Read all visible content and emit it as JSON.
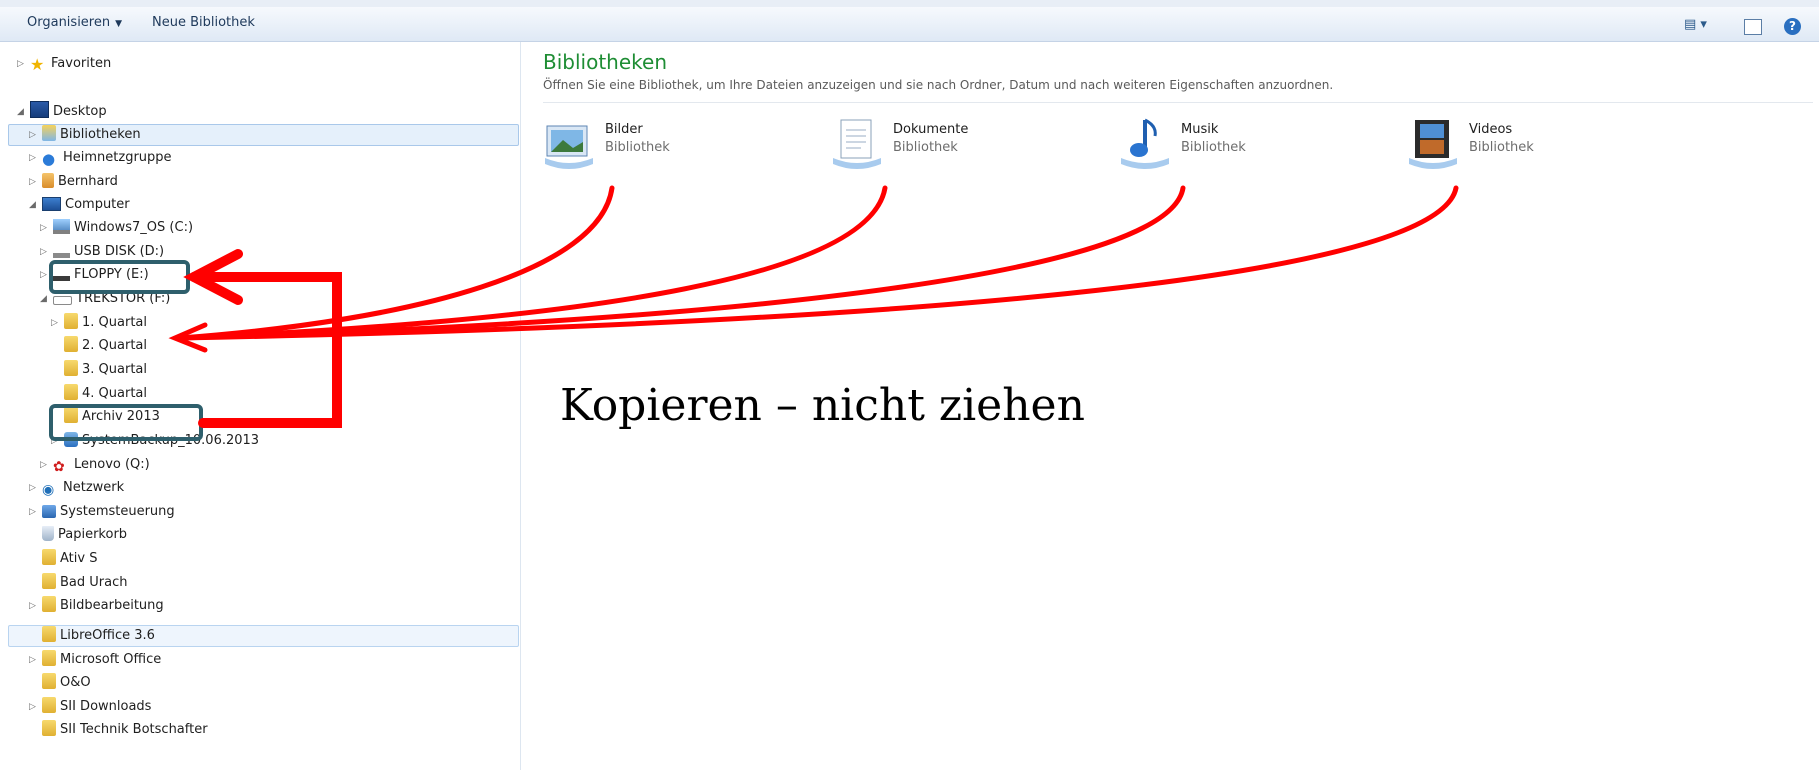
{
  "toolbar": {
    "organize_label": "Organisieren",
    "new_library_label": "Neue Bibliothek"
  },
  "nav": {
    "favorites": "Favoriten",
    "desktop": "Desktop",
    "libraries": "Bibliotheken",
    "homegroup": "Heimnetzgruppe",
    "user": "Bernhard",
    "computer": "Computer",
    "drive_c": "Windows7_OS (C:)",
    "drive_d": "USB DISK (D:)",
    "drive_e": "FLOPPY (E:)",
    "drive_f": "TREKSTOR (F:)",
    "q1": "1. Quartal",
    "q2": "2. Quartal",
    "q3": "3. Quartal",
    "q4": "4. Quartal",
    "archive": "Archiv 2013",
    "backup": "SystemBackup_10.06.2013",
    "drive_q": "Lenovo (Q:)",
    "network": "Netzwerk",
    "control_panel": "Systemsteuerung",
    "recycle_bin": "Papierkorb",
    "ativ": "Ativ S",
    "bad_urach": "Bad Urach",
    "image_editing": "Bildbearbeitung",
    "libreoffice": "LibreOffice 3.6",
    "ms_office": "Microsoft Office",
    "oo": "O&O",
    "sii_downloads": "SII Downloads",
    "sii_tech": "SII Technik Botschafter"
  },
  "main": {
    "title": "Bibliotheken",
    "subtitle": "Öffnen Sie eine Bibliothek, um Ihre Dateien anzuzeigen und sie nach Ordner, Datum und nach weiteren Eigenschaften anzuordnen.",
    "libraries": [
      {
        "name": "Bilder",
        "kind": "Bibliothek"
      },
      {
        "name": "Dokumente",
        "kind": "Bibliothek"
      },
      {
        "name": "Musik",
        "kind": "Bibliothek"
      },
      {
        "name": "Videos",
        "kind": "Bibliothek"
      }
    ]
  },
  "annotation": {
    "caption": "Kopieren – nicht ziehen",
    "arrow_color": "#ff0000",
    "box_color": "#2e5f6c"
  },
  "icons": [
    "star-icon",
    "desktop-icon",
    "library-icon",
    "homegroup-icon",
    "user-icon",
    "computer-icon",
    "drive-icon",
    "usb-icon",
    "floppy-icon",
    "folder-icon",
    "backup-icon",
    "recycle-bin-icon",
    "network-icon",
    "control-panel-icon",
    "pictures-icon",
    "documents-icon",
    "music-icon",
    "videos-icon",
    "view-icon",
    "preview-pane-icon",
    "help-icon"
  ]
}
